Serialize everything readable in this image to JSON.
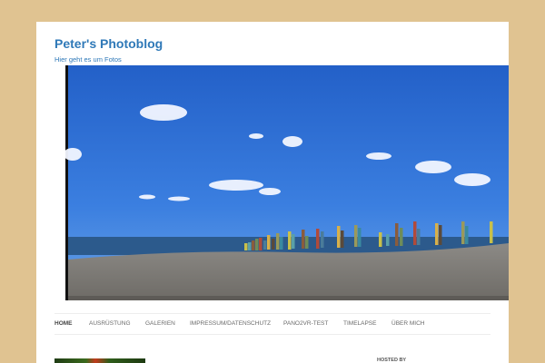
{
  "site": {
    "title": "Peter's Photoblog",
    "description": "Hier geht es um Fotos"
  },
  "nav": {
    "items": [
      {
        "label": "Home",
        "current": true
      },
      {
        "label": "Ausrüstung"
      },
      {
        "label": "Galerien"
      },
      {
        "label": "Impressum/Datenschutz"
      },
      {
        "label": "Pano2VR-Test"
      },
      {
        "label": "Timelapse"
      },
      {
        "label": "Über mich"
      }
    ]
  },
  "sidebar": {
    "heading": "HOSTED BY"
  },
  "colors": {
    "background": "#e0c391",
    "link": "#2f79b8",
    "sky": "#2e6fd2"
  }
}
